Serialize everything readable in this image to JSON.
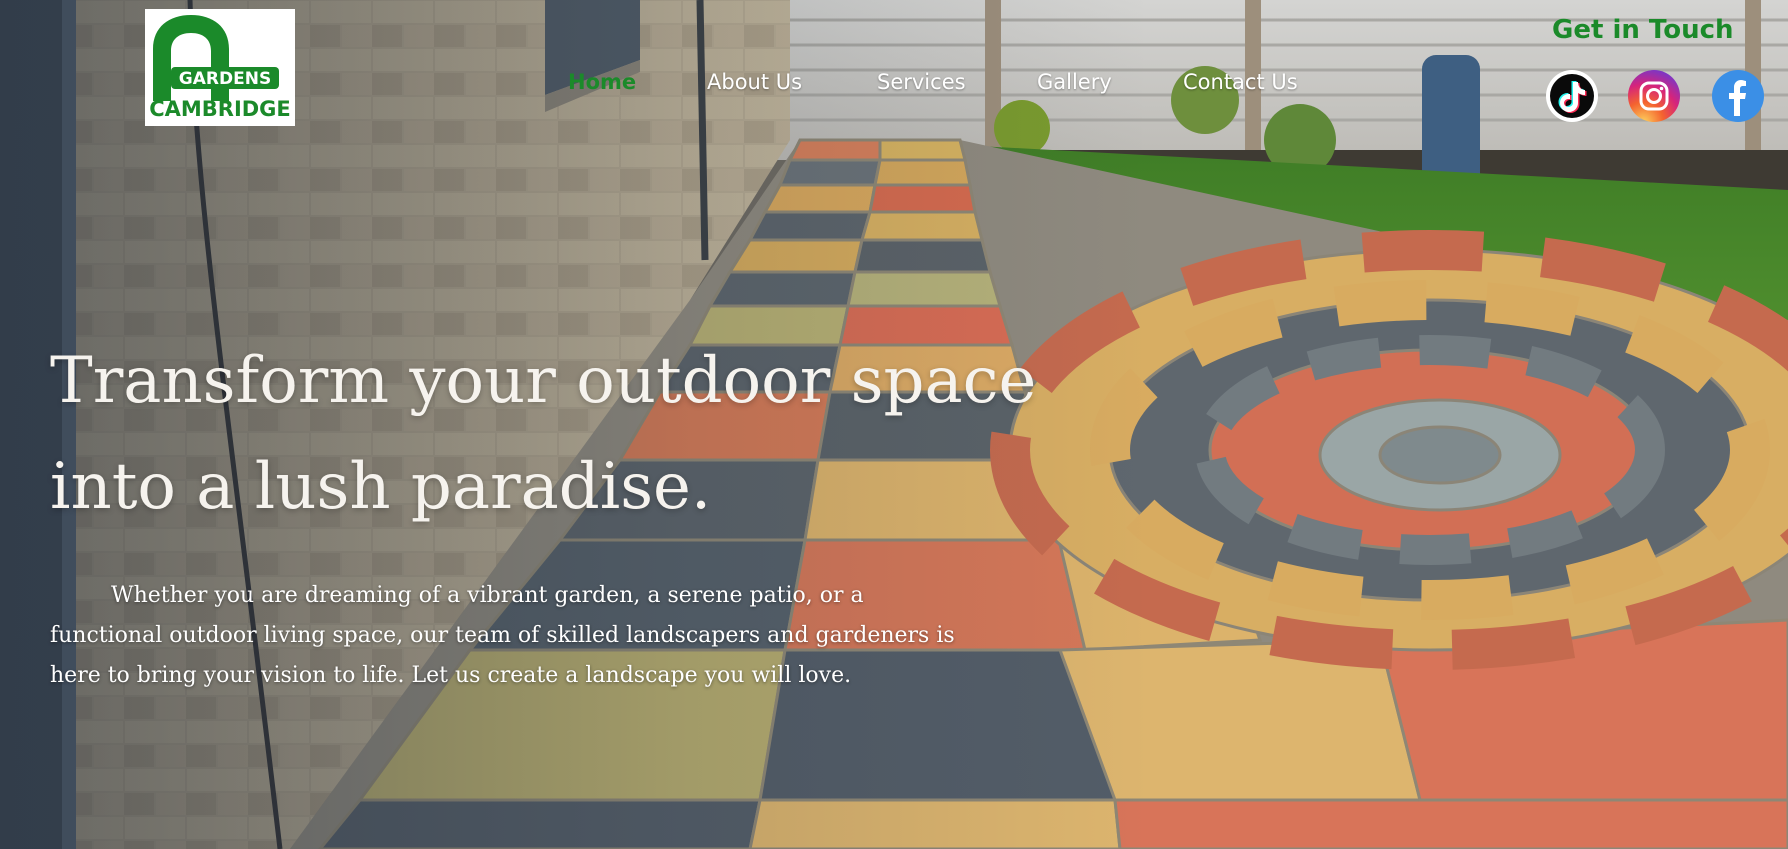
{
  "brand": {
    "logo_top": "GARDENS",
    "logo_bottom": "CAMBRIDGE",
    "brand_color": "#1b8a2a"
  },
  "nav": {
    "items": [
      {
        "label": "Home",
        "active": true
      },
      {
        "label": "About Us",
        "active": false
      },
      {
        "label": "Services",
        "active": false
      },
      {
        "label": "Gallery",
        "active": false
      },
      {
        "label": "Contact Us",
        "active": false
      }
    ]
  },
  "contact_link": "Get in Touch",
  "social": [
    {
      "name": "tiktok-icon"
    },
    {
      "name": "instagram-icon"
    },
    {
      "name": "facebook-icon"
    }
  ],
  "hero": {
    "headline": [
      "Transform your outdoor space",
      "into a lush paradise."
    ],
    "intro": [
      "Whether you are dreaming of a vibrant garden, a serene patio, or a",
      "functional outdoor living space, our team of skilled landscapers and gardeners is",
      "here to bring your vision to life. Let us create a landscape you will love."
    ]
  }
}
